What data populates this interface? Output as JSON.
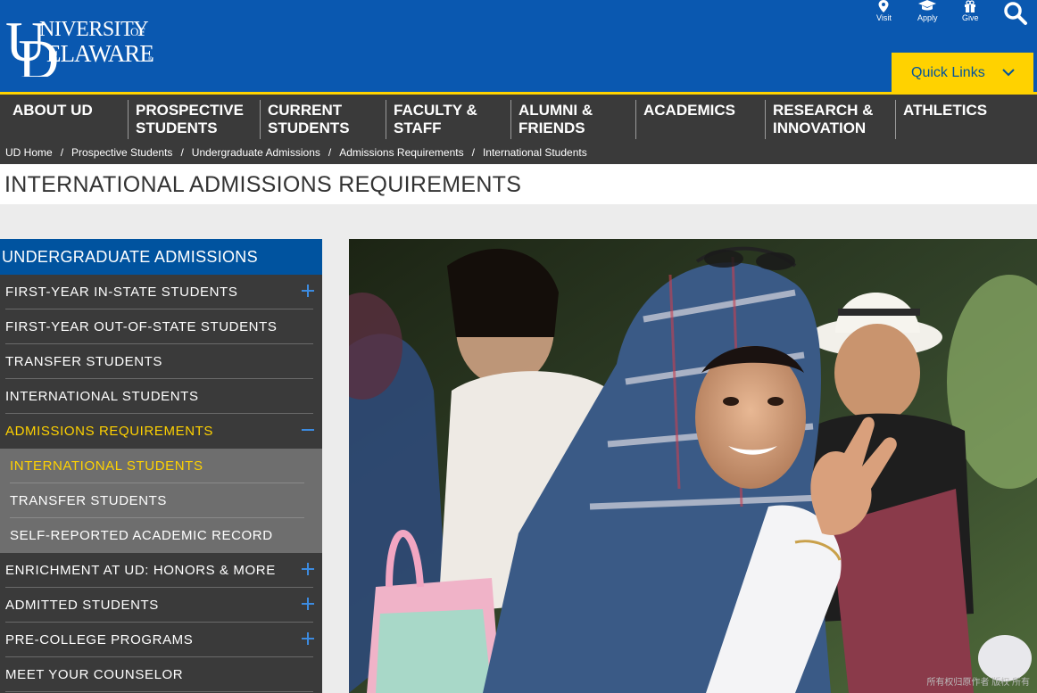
{
  "header": {
    "logo_text_line1": "UNIVERSITY OF",
    "logo_text_line2": "DELAWARE",
    "utility": [
      {
        "label": "Visit",
        "icon": "map-pin-icon"
      },
      {
        "label": "Apply",
        "icon": "graduation-cap-icon"
      },
      {
        "label": "Give",
        "icon": "gift-icon"
      }
    ],
    "search_icon": "search-icon",
    "quick_links_label": "Quick Links",
    "colors": {
      "brand_blue": "#0a58b0",
      "gold": "#ffd200",
      "nav_gray": "#3a3a3a",
      "sidebar_blue": "#00539f"
    }
  },
  "nav": {
    "items": [
      {
        "line1": "ABOUT UD",
        "line2": ""
      },
      {
        "line1": "PROSPECTIVE",
        "line2": "STUDENTS"
      },
      {
        "line1": "CURRENT",
        "line2": "STUDENTS"
      },
      {
        "line1": "FACULTY &",
        "line2": "STAFF"
      },
      {
        "line1": "ALUMNI &",
        "line2": "FRIENDS"
      },
      {
        "line1": "ACADEMICS",
        "line2": ""
      },
      {
        "line1": "RESEARCH &",
        "line2": "INNOVATION"
      },
      {
        "line1": "ATHLETICS",
        "line2": ""
      }
    ]
  },
  "breadcrumb": {
    "items": [
      "UD Home",
      "Prospective Students",
      "Undergraduate Admissions",
      "Admissions Requirements",
      "International Students"
    ],
    "separator": "/"
  },
  "page": {
    "title": "INTERNATIONAL ADMISSIONS REQUIREMENTS"
  },
  "sidebar": {
    "heading": "UNDERGRADUATE ADMISSIONS",
    "items": [
      {
        "label": "FIRST-YEAR IN-STATE STUDENTS",
        "toggle": "+"
      },
      {
        "label": "FIRST-YEAR OUT-OF-STATE STUDENTS",
        "toggle": ""
      },
      {
        "label": "TRANSFER STUDENTS",
        "toggle": ""
      },
      {
        "label": "INTERNATIONAL STUDENTS",
        "toggle": ""
      },
      {
        "label": "ADMISSIONS REQUIREMENTS",
        "toggle": "−"
      },
      {
        "label": "ENRICHMENT AT UD: HONORS & MORE",
        "toggle": "+"
      },
      {
        "label": "ADMITTED STUDENTS",
        "toggle": "+"
      },
      {
        "label": "PRE-COLLEGE PROGRAMS",
        "toggle": "+"
      },
      {
        "label": "MEET YOUR COUNSELOR",
        "toggle": ""
      }
    ],
    "subitems": [
      {
        "label": "INTERNATIONAL STUDENTS"
      },
      {
        "label": "TRANSFER STUDENTS"
      },
      {
        "label": "SELF-REPORTED ACADEMIC RECORD"
      }
    ]
  },
  "hero": {
    "watermark": "所有权归原作者 版权 所有"
  }
}
